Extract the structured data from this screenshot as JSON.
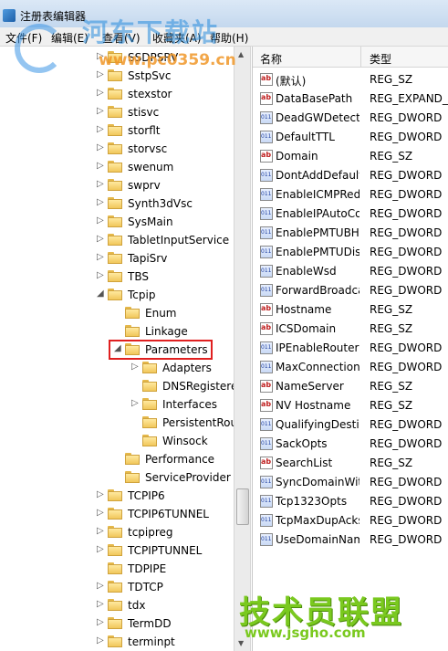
{
  "window": {
    "title": "注册表编辑器"
  },
  "menu": [
    "文件(F)",
    "编辑(E)",
    "查看(V)",
    "收藏夹(A)",
    "帮助(H)"
  ],
  "watermarks": {
    "top_title": "河东下载站",
    "top_url": "www.pc0359.cn",
    "bottom_title": "技术员联盟",
    "bottom_url": "www.jsgho.com"
  },
  "tree": [
    {
      "label": "SSDPSRV",
      "level": 0,
      "arrow": "collapsed"
    },
    {
      "label": "SstpSvc",
      "level": 0,
      "arrow": "collapsed"
    },
    {
      "label": "stexstor",
      "level": 0,
      "arrow": "collapsed"
    },
    {
      "label": "stisvc",
      "level": 0,
      "arrow": "collapsed"
    },
    {
      "label": "storflt",
      "level": 0,
      "arrow": "collapsed"
    },
    {
      "label": "storvsc",
      "level": 0,
      "arrow": "collapsed"
    },
    {
      "label": "swenum",
      "level": 0,
      "arrow": "collapsed"
    },
    {
      "label": "swprv",
      "level": 0,
      "arrow": "collapsed"
    },
    {
      "label": "Synth3dVsc",
      "level": 0,
      "arrow": "collapsed"
    },
    {
      "label": "SysMain",
      "level": 0,
      "arrow": "collapsed"
    },
    {
      "label": "TabletInputService",
      "level": 0,
      "arrow": "collapsed"
    },
    {
      "label": "TapiSrv",
      "level": 0,
      "arrow": "collapsed"
    },
    {
      "label": "TBS",
      "level": 0,
      "arrow": "collapsed"
    },
    {
      "label": "Tcpip",
      "level": 0,
      "arrow": "expanded"
    },
    {
      "label": "Enum",
      "level": 1,
      "arrow": "none"
    },
    {
      "label": "Linkage",
      "level": 1,
      "arrow": "none"
    },
    {
      "label": "Parameters",
      "level": 1,
      "arrow": "expanded",
      "selected": true
    },
    {
      "label": "Adapters",
      "level": 2,
      "arrow": "collapsed"
    },
    {
      "label": "DNSRegisteredAdapters",
      "level": 2,
      "arrow": "none"
    },
    {
      "label": "Interfaces",
      "level": 2,
      "arrow": "collapsed"
    },
    {
      "label": "PersistentRoutes",
      "level": 2,
      "arrow": "none"
    },
    {
      "label": "Winsock",
      "level": 2,
      "arrow": "none"
    },
    {
      "label": "Performance",
      "level": 1,
      "arrow": "none"
    },
    {
      "label": "ServiceProvider",
      "level": 1,
      "arrow": "none"
    },
    {
      "label": "TCPIP6",
      "level": 0,
      "arrow": "collapsed"
    },
    {
      "label": "TCPIP6TUNNEL",
      "level": 0,
      "arrow": "collapsed"
    },
    {
      "label": "tcpipreg",
      "level": 0,
      "arrow": "collapsed"
    },
    {
      "label": "TCPIPTUNNEL",
      "level": 0,
      "arrow": "collapsed"
    },
    {
      "label": "TDPIPE",
      "level": 0,
      "arrow": "none"
    },
    {
      "label": "TDTCP",
      "level": 0,
      "arrow": "collapsed"
    },
    {
      "label": "tdx",
      "level": 0,
      "arrow": "collapsed"
    },
    {
      "label": "TermDD",
      "level": 0,
      "arrow": "collapsed"
    },
    {
      "label": "terminpt",
      "level": 0,
      "arrow": "collapsed"
    }
  ],
  "values_header": {
    "name": "名称",
    "type": "类型"
  },
  "values": [
    {
      "name": "(默认)",
      "type": "REG_SZ",
      "icon": "string-value-icon"
    },
    {
      "name": "DataBasePath",
      "type": "REG_EXPAND_SZ",
      "icon": "string-value-icon"
    },
    {
      "name": "DeadGWDetectDefault",
      "type": "REG_DWORD",
      "icon": "dword-value-icon"
    },
    {
      "name": "DefaultTTL",
      "type": "REG_DWORD",
      "icon": "dword-value-icon"
    },
    {
      "name": "Domain",
      "type": "REG_SZ",
      "icon": "string-value-icon"
    },
    {
      "name": "DontAddDefaultGateway",
      "type": "REG_DWORD",
      "icon": "dword-value-icon"
    },
    {
      "name": "EnableICMPRedirect",
      "type": "REG_DWORD",
      "icon": "dword-value-icon"
    },
    {
      "name": "EnableIPAutoConfig",
      "type": "REG_DWORD",
      "icon": "dword-value-icon"
    },
    {
      "name": "EnablePMTUBHDetect",
      "type": "REG_DWORD",
      "icon": "dword-value-icon"
    },
    {
      "name": "EnablePMTUDiscovery",
      "type": "REG_DWORD",
      "icon": "dword-value-icon"
    },
    {
      "name": "EnableWsd",
      "type": "REG_DWORD",
      "icon": "dword-value-icon"
    },
    {
      "name": "ForwardBroadcasts",
      "type": "REG_DWORD",
      "icon": "dword-value-icon"
    },
    {
      "name": "Hostname",
      "type": "REG_SZ",
      "icon": "string-value-icon"
    },
    {
      "name": "ICSDomain",
      "type": "REG_SZ",
      "icon": "string-value-icon"
    },
    {
      "name": "IPEnableRouter",
      "type": "REG_DWORD",
      "icon": "dword-value-icon"
    },
    {
      "name": "MaxConnectionsPerServer",
      "type": "REG_DWORD",
      "icon": "dword-value-icon"
    },
    {
      "name": "NameServer",
      "type": "REG_SZ",
      "icon": "string-value-icon"
    },
    {
      "name": "NV Hostname",
      "type": "REG_SZ",
      "icon": "string-value-icon"
    },
    {
      "name": "QualifyingDestinationThreshold",
      "type": "REG_DWORD",
      "icon": "dword-value-icon"
    },
    {
      "name": "SackOpts",
      "type": "REG_DWORD",
      "icon": "dword-value-icon"
    },
    {
      "name": "SearchList",
      "type": "REG_SZ",
      "icon": "string-value-icon"
    },
    {
      "name": "SyncDomainWithMembership",
      "type": "REG_DWORD",
      "icon": "dword-value-icon"
    },
    {
      "name": "Tcp1323Opts",
      "type": "REG_DWORD",
      "icon": "dword-value-icon"
    },
    {
      "name": "TcpMaxDupAcks",
      "type": "REG_DWORD",
      "icon": "dword-value-icon"
    },
    {
      "name": "UseDomainNameDevolution",
      "type": "REG_DWORD",
      "icon": "dword-value-icon"
    }
  ]
}
